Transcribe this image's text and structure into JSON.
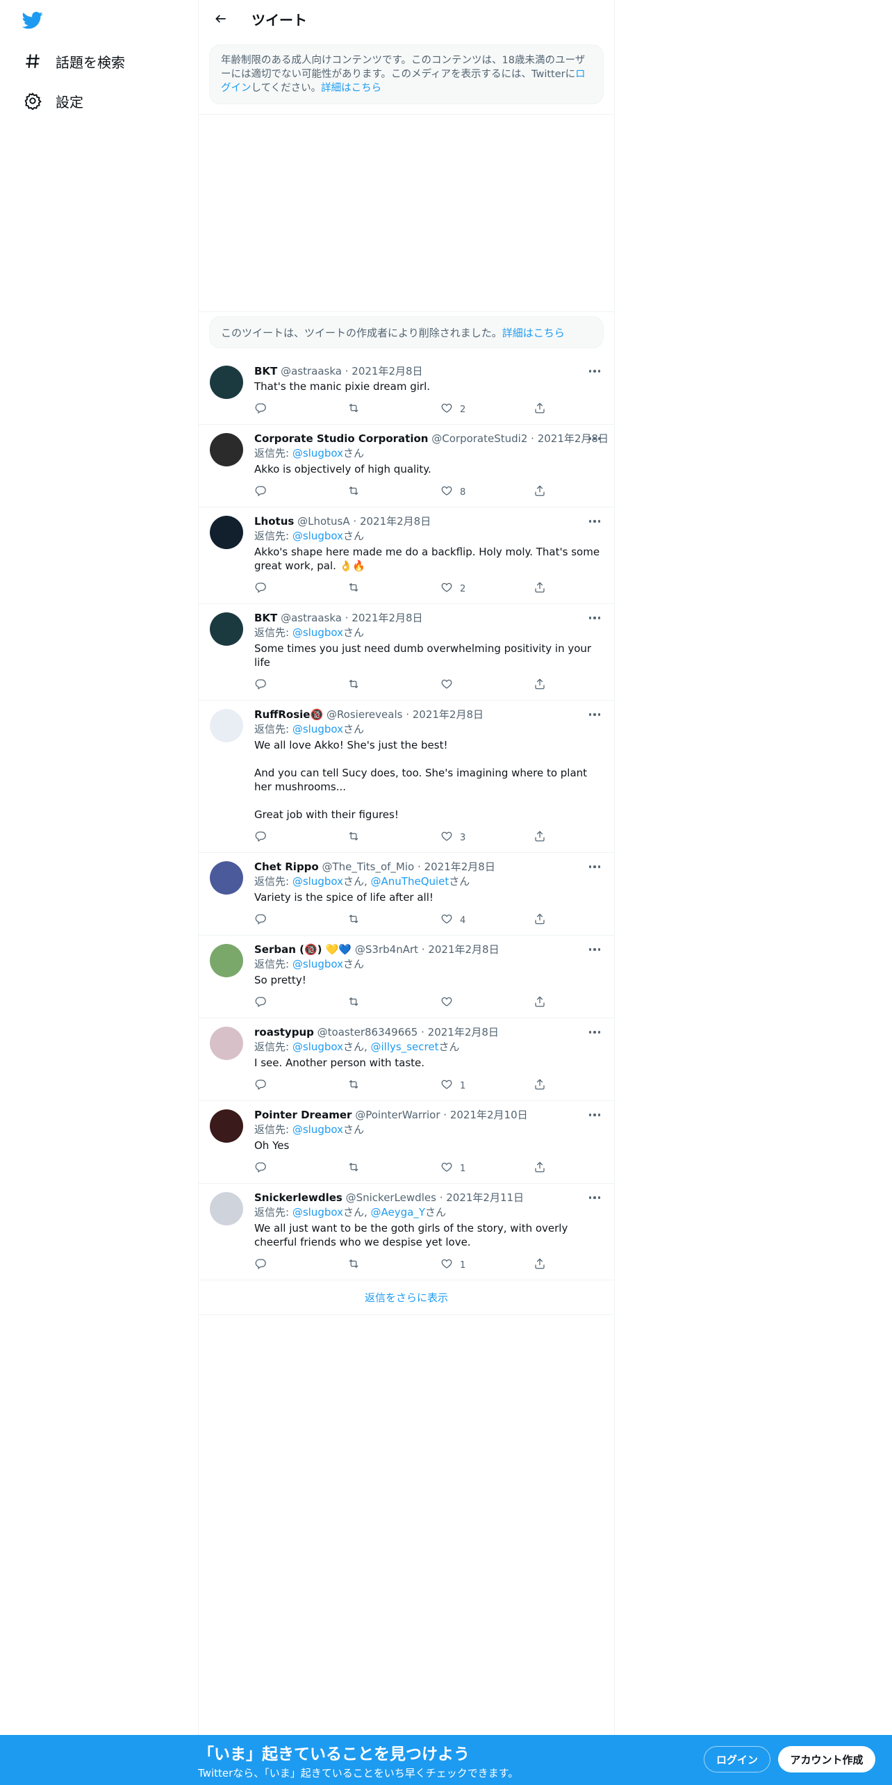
{
  "sidebar": {
    "items": [
      {
        "label": "話題を検索",
        "icon": "hashtag-icon"
      },
      {
        "label": "設定",
        "icon": "gear-icon"
      }
    ]
  },
  "header": {
    "title": "ツイート"
  },
  "notice": {
    "text_before": "年齢制限のある成人向けコンテンツです。このコンテンツは、18歳未満のユーザーには適切でない可能性があります。このメディアを表示するには、Twitterに",
    "login_link": "ログイン",
    "text_after": "してください。",
    "more_link": "詳細はこちら"
  },
  "deleted": {
    "text": "このツイートは、ツイートの作成者により削除されました。",
    "more_link": "詳細はこちら"
  },
  "reply_to_label": "返信先: ",
  "san": "さん",
  "replies": [
    {
      "name": "BKT",
      "handle": "@astraaska",
      "date": "2021年2月8日",
      "reply_to": [],
      "text": "That's the manic pixie dream girl.",
      "likes": "2"
    },
    {
      "name": "Corporate Studio Corporation",
      "handle": "@CorporateStudi2",
      "date": "2021年2月8日",
      "reply_to": [
        "@slugbox"
      ],
      "text": "Akko is objectively of high quality.",
      "likes": "8"
    },
    {
      "name": "Lhotus",
      "handle": "@LhotusA",
      "date": "2021年2月8日",
      "reply_to": [
        "@slugbox"
      ],
      "text": "Akko's shape here made me do a backflip. Holy moly. That's some great work, pal. 👌🔥",
      "likes": "2"
    },
    {
      "name": "BKT",
      "handle": "@astraaska",
      "date": "2021年2月8日",
      "reply_to": [
        "@slugbox"
      ],
      "text": "Some times you just need dumb overwhelming positivity in your life",
      "likes": ""
    },
    {
      "name": "RuffRosie🔞",
      "handle": "@Rosiereveals",
      "date": "2021年2月8日",
      "reply_to": [
        "@slugbox"
      ],
      "text": "We all love Akko! She's just the best!\n\nAnd you can tell Sucy does, too. She's imagining where to plant her mushrooms...\n\nGreat job with their figures!",
      "likes": "3"
    },
    {
      "name": "Chet Rippo",
      "handle": "@The_Tits_of_Mio",
      "date": "2021年2月8日",
      "reply_to": [
        "@slugbox",
        "@AnuTheQuiet"
      ],
      "text": "Variety is the spice of life after all!",
      "likes": "4"
    },
    {
      "name": "Serban (🔞) 💛💙",
      "handle": "@S3rb4nArt",
      "date": "2021年2月8日",
      "reply_to": [
        "@slugbox"
      ],
      "text": "So pretty!",
      "likes": ""
    },
    {
      "name": "roastypup",
      "handle": "@toaster86349665",
      "date": "2021年2月8日",
      "reply_to": [
        "@slugbox",
        "@illys_secret"
      ],
      "text": "I see. Another person with taste.",
      "likes": "1"
    },
    {
      "name": "Pointer Dreamer",
      "handle": "@PointerWarrior",
      "date": "2021年2月10日",
      "reply_to": [
        "@slugbox"
      ],
      "text": "Oh Yes",
      "likes": "1"
    },
    {
      "name": "Snickerlewdles",
      "handle": "@SnickerLewdles",
      "date": "2021年2月11日",
      "reply_to": [
        "@slugbox",
        "@Aeyga_Y"
      ],
      "text": "We all just want to be the goth girls of the story, with overly cheerful friends who we despise yet love.",
      "likes": "1"
    }
  ],
  "show_more": "返信をさらに表示",
  "bottom": {
    "title": "「いま」起きていることを見つけよう",
    "subtitle": "Twitterなら、「いま」起きていることをいち早くチェックできます。",
    "login": "ログイン",
    "signup": "アカウント作成"
  },
  "colors": {
    "accent": "#1d9bf0",
    "text": "#0f1419",
    "muted": "#536471",
    "border": "#eff3f4"
  }
}
